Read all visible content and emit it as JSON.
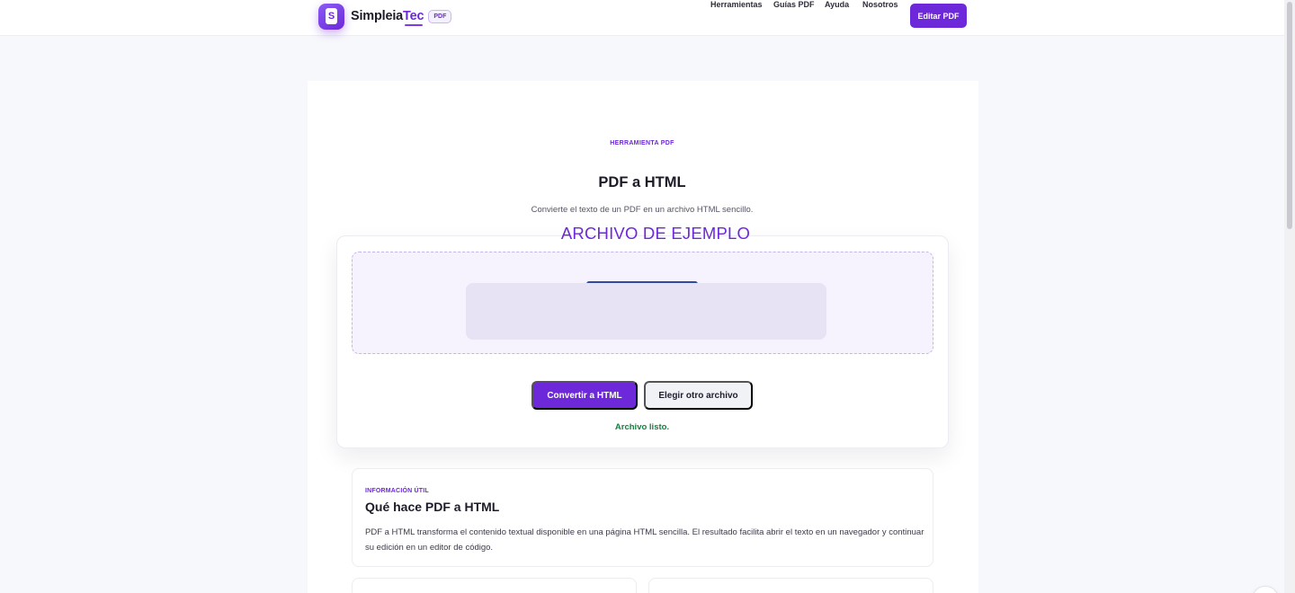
{
  "header": {
    "brand": {
      "logo_letter": "S",
      "name_main": "Simpleia",
      "name_accent": "Tec",
      "badge": "PDF"
    },
    "nav": [
      {
        "label": "Herramientas"
      },
      {
        "label": "Guías PDF"
      },
      {
        "label": "Ayuda"
      },
      {
        "label": "Nosotros"
      }
    ],
    "cta_label": "Editar PDF"
  },
  "tool": {
    "eyebrow": "HERRAMIENTA PDF",
    "title": "PDF a HTML",
    "subtitle": "Convierte el texto de un PDF en un archivo HTML sencillo.",
    "sample_label": "ARCHIVO DE EJEMPLO",
    "convert_button": "Convertir a HTML",
    "choose_button": "Elegir otro archivo",
    "status": "Archivo listo."
  },
  "info": {
    "eyebrow": "INFORMACIÓN ÚTIL",
    "title": "Qué hace PDF a HTML",
    "text": "PDF a HTML transforma el contenido textual disponible en una página HTML sencilla. El resultado facilita abrir el texto en un navegador y continuar su edición en un editor de código."
  },
  "colors": {
    "accent": "#6d28d9",
    "status_ok": "#15803d",
    "page_bg": "#f7f8fb"
  }
}
